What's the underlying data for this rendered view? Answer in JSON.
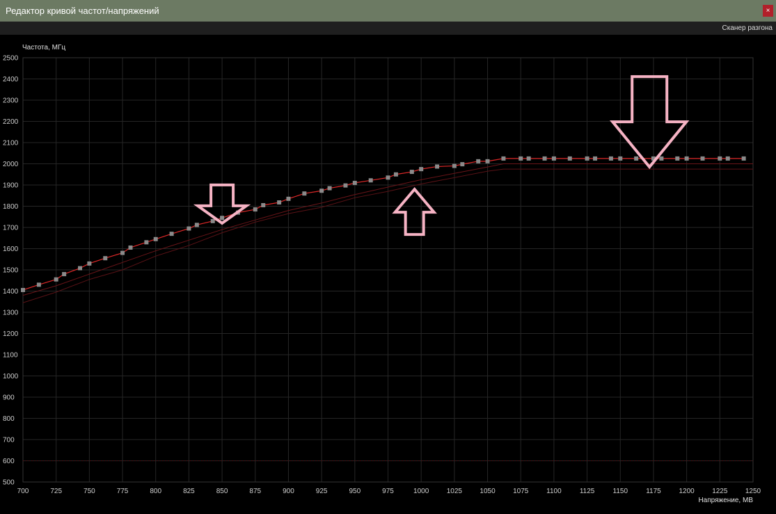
{
  "window": {
    "title": "Редактор кривой частот/напряжений",
    "close_glyph": "×"
  },
  "toolbar": {
    "scanner_label": "Сканер разгона"
  },
  "chart_data": {
    "type": "line",
    "ylabel": "Частота, МГц",
    "xlabel": "Напряжение, МВ",
    "xlim": [
      700,
      1250
    ],
    "ylim": [
      500,
      2500
    ],
    "x_ticks": [
      "700",
      "725",
      "750",
      "775",
      "800",
      "825",
      "850",
      "875",
      "900",
      "925",
      "950",
      "975",
      "1000",
      "1025",
      "1050",
      "1075",
      "1100",
      "1125",
      "1150",
      "1175",
      "1200",
      "1225",
      "1250"
    ],
    "y_ticks": [
      "500",
      "600",
      "700",
      "800",
      "900",
      "1000",
      "1100",
      "1200",
      "1300",
      "1400",
      "1500",
      "1600",
      "1700",
      "1800",
      "1900",
      "2000",
      "2100",
      "2200",
      "2300",
      "2400",
      "2500"
    ],
    "grid": true,
    "series": [
      {
        "color": "#e02828",
        "marker_color": "#8a8a8a",
        "points": [
          [
            700,
            1405
          ],
          [
            712,
            1430
          ],
          [
            725,
            1455
          ],
          [
            731,
            1480
          ],
          [
            743,
            1508
          ],
          [
            750,
            1530
          ],
          [
            762,
            1555
          ],
          [
            775,
            1580
          ],
          [
            781,
            1605
          ],
          [
            793,
            1630
          ],
          [
            800,
            1645
          ],
          [
            812,
            1670
          ],
          [
            825,
            1695
          ],
          [
            831,
            1712
          ],
          [
            843,
            1730
          ],
          [
            850,
            1745
          ],
          [
            862,
            1770
          ],
          [
            875,
            1785
          ],
          [
            881,
            1805
          ],
          [
            893,
            1818
          ],
          [
            900,
            1835
          ],
          [
            912,
            1860
          ],
          [
            925,
            1873
          ],
          [
            931,
            1885
          ],
          [
            943,
            1898
          ],
          [
            950,
            1910
          ],
          [
            962,
            1922
          ],
          [
            975,
            1935
          ],
          [
            981,
            1950
          ],
          [
            993,
            1962
          ],
          [
            1000,
            1975
          ],
          [
            1012,
            1987
          ],
          [
            1025,
            1990
          ],
          [
            1031,
            1998
          ],
          [
            1043,
            2012
          ],
          [
            1050,
            2012
          ],
          [
            1062,
            2025
          ],
          [
            1075,
            2025
          ],
          [
            1081,
            2025
          ],
          [
            1093,
            2025
          ],
          [
            1100,
            2025
          ],
          [
            1112,
            2025
          ],
          [
            1125,
            2025
          ],
          [
            1131,
            2025
          ],
          [
            1143,
            2025
          ],
          [
            1150,
            2025
          ],
          [
            1162,
            2025
          ],
          [
            1175,
            2025
          ],
          [
            1181,
            2025
          ],
          [
            1193,
            2025
          ],
          [
            1200,
            2025
          ],
          [
            1212,
            2025
          ],
          [
            1225,
            2025
          ],
          [
            1231,
            2025
          ],
          [
            1243,
            2025
          ]
        ]
      },
      {
        "color": "#6a1418",
        "points": [
          [
            700,
            1380
          ],
          [
            725,
            1425
          ],
          [
            750,
            1480
          ],
          [
            775,
            1535
          ],
          [
            800,
            1590
          ],
          [
            825,
            1640
          ],
          [
            850,
            1690
          ],
          [
            875,
            1735
          ],
          [
            900,
            1780
          ],
          [
            925,
            1815
          ],
          [
            950,
            1855
          ],
          [
            975,
            1890
          ],
          [
            1000,
            1925
          ],
          [
            1025,
            1955
          ],
          [
            1050,
            1985
          ],
          [
            1062,
            2000
          ],
          [
            1100,
            2000
          ],
          [
            1150,
            2000
          ],
          [
            1200,
            2000
          ],
          [
            1250,
            2000
          ]
        ]
      },
      {
        "color": "#5a1216",
        "points": [
          [
            700,
            1345
          ],
          [
            725,
            1395
          ],
          [
            750,
            1455
          ],
          [
            775,
            1500
          ],
          [
            800,
            1565
          ],
          [
            825,
            1615
          ],
          [
            850,
            1675
          ],
          [
            875,
            1725
          ],
          [
            900,
            1765
          ],
          [
            925,
            1795
          ],
          [
            950,
            1840
          ],
          [
            975,
            1870
          ],
          [
            1000,
            1905
          ],
          [
            1025,
            1935
          ],
          [
            1050,
            1965
          ],
          [
            1062,
            1975
          ],
          [
            1100,
            1975
          ],
          [
            1150,
            1975
          ],
          [
            1200,
            1975
          ],
          [
            1250,
            1975
          ]
        ]
      }
    ],
    "baseline": {
      "y": 600,
      "color": "#4a1014"
    },
    "annotations": [
      {
        "type": "arrow-down",
        "color": "#f6b3c4",
        "at": [
          850,
          1720
        ]
      },
      {
        "type": "arrow-up",
        "color": "#f6b3c4",
        "at": [
          995,
          1880
        ]
      },
      {
        "type": "arrow-down",
        "color": "#f6b3c4",
        "at": [
          1172,
          1985
        ]
      }
    ]
  }
}
